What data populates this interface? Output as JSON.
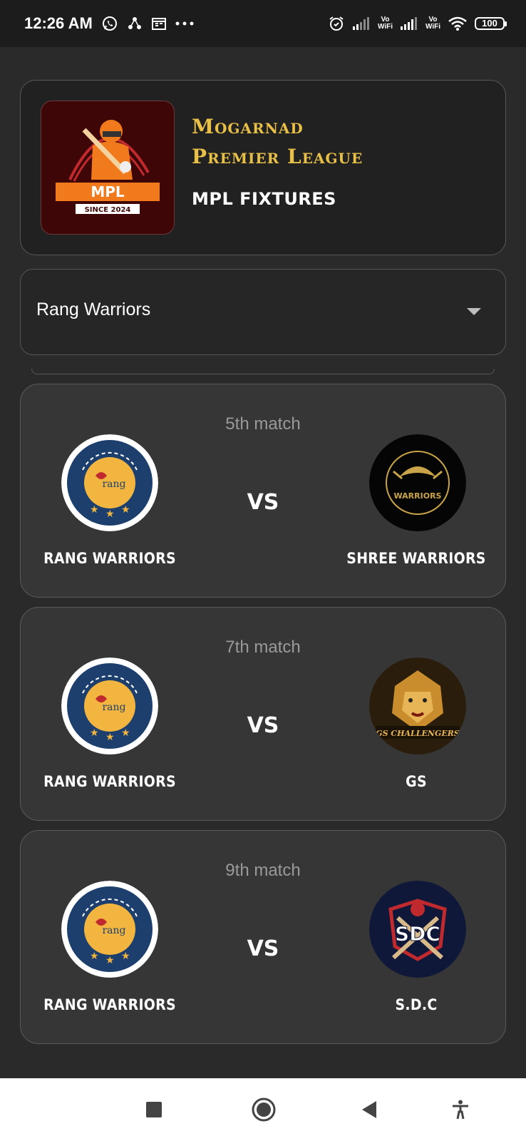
{
  "status_bar": {
    "time": "12:26 AM",
    "left_icons": [
      "whatsapp-icon",
      "share-icon",
      "calendar-icon",
      "more-dots-icon"
    ],
    "volte1": "Vo\nWiFi",
    "volte2": "Vo\nWiFi",
    "battery": "100"
  },
  "header": {
    "league_line1": "Mogarnad",
    "league_line2": "Premier League",
    "subtitle": "MPL FIXTURES",
    "logo": {
      "text": "MPL",
      "since": "SINCE 2024"
    }
  },
  "dropdown": {
    "selected": "Rang Warriors"
  },
  "matches": [
    {
      "title": "5th match",
      "team1": {
        "name": "RANG WARRIORS",
        "logo": "rang-warriors-logo"
      },
      "vs": "VS",
      "team2": {
        "name": "SHREE WARRIORS",
        "logo": "shree-warriors-logo",
        "logo_text": "WARRIORS"
      }
    },
    {
      "title": "7th match",
      "team1": {
        "name": "RANG WARRIORS",
        "logo": "rang-warriors-logo"
      },
      "vs": "VS",
      "team2": {
        "name": "GS",
        "logo": "gs-challengers-logo",
        "logo_text": "GS CHALLENGERS"
      }
    },
    {
      "title": "9th match",
      "team1": {
        "name": "RANG WARRIORS",
        "logo": "rang-warriors-logo"
      },
      "vs": "VS",
      "team2": {
        "name": "S.D.C",
        "logo": "sdc-logo",
        "logo_text": "SDC"
      }
    }
  ],
  "rang_logo_text": {
    "ring": "RANG WARRIORS",
    "center": "rang"
  },
  "colors": {
    "background": "#2a2a2a",
    "card": "#363636",
    "league_gold": "#e8c048",
    "muted_text": "#9a9a9a"
  }
}
